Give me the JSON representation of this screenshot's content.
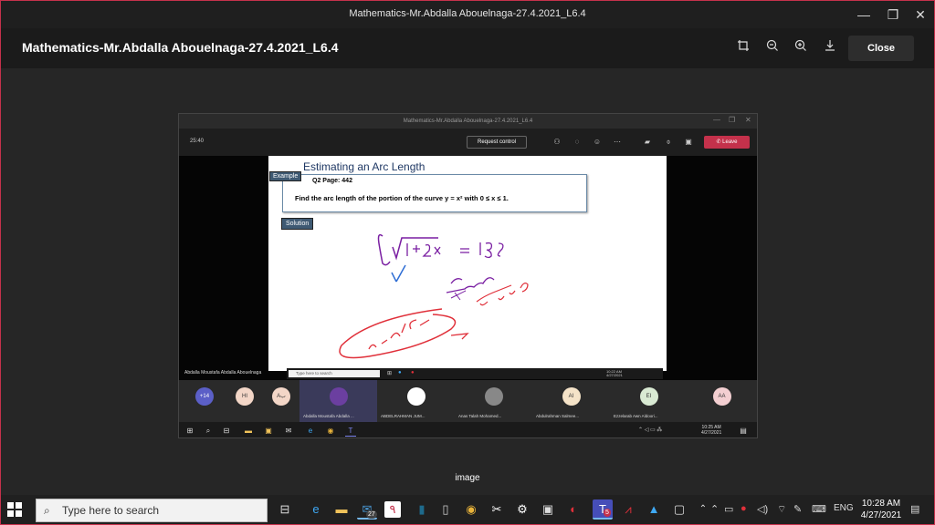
{
  "window": {
    "title": "Mathematics-Mr.Abdalla Abouelnaga-27.4.2021_L6.4",
    "minimize_glyph": "—",
    "restore_glyph": "❐",
    "close_glyph": "✕"
  },
  "viewer": {
    "title": "Mathematics-Mr.Abdalla Abouelnaga-27.4.2021_L6.4",
    "tools": [
      "crop-icon",
      "zoom-out-icon",
      "zoom-in-icon",
      "download-icon"
    ],
    "close_label": "Close",
    "caption": "image"
  },
  "shot": {
    "window_title": "Mathematics-Mr.Abdalla Abouelnaga-27.4.2021_L6.4",
    "timer": "25:40",
    "request_control": "Request control",
    "leave_label": "Leave",
    "presenter": "Abdalla Moustafa Abdalla Abouelnaga",
    "mini_search": "Type here to search",
    "mini_clock": "10:22 AM\n4/27/2021",
    "slide": {
      "title": "Estimating an Arc Length",
      "example_label": "Example",
      "question": "Q2 Page: 442",
      "problem": "Find the arc length of the portion of the curve y = x² with 0 ≤ x ≤ 1.",
      "solution_label": "Solution"
    },
    "participants": [
      {
        "initials": "+14",
        "name": "",
        "color": "#5b5fc7"
      },
      {
        "initials": "HI",
        "name": "",
        "color": "#f3d6c7"
      },
      {
        "initials": "Aب",
        "name": "",
        "color": "#f3d6c7"
      },
      {
        "initials": "",
        "name": "Abdalla Moustafa Abdalla ...",
        "color": "#6b3fa0"
      },
      {
        "initials": "",
        "name": "ABDELRAHMAN JUM...",
        "color": "#ffffff"
      },
      {
        "initials": "",
        "name": "Anas Talah Mohamed...",
        "color": "#888888"
      },
      {
        "initials": "AI",
        "name": "Abdulrahman Salmee...",
        "color": "#f5e3c8"
      },
      {
        "initials": "EI",
        "name": "Ezzelarab Awn Aldoori...",
        "color": "#d9ead3"
      },
      {
        "initials": "AA",
        "name": "",
        "color": "#f3cfd1"
      }
    ],
    "taskbar_clock": "10:25 AM\n4/27/2021"
  },
  "taskbar": {
    "search_placeholder": "Type here to search",
    "badge_mail": "27",
    "badge_teams": "5",
    "language": "ENG",
    "time": "10:28 AM",
    "date": "4/27/2021"
  },
  "colors": {
    "accent_red": "#c4314b",
    "teams_purple": "#5b5fc7",
    "slide_box": "#3f5a73"
  }
}
